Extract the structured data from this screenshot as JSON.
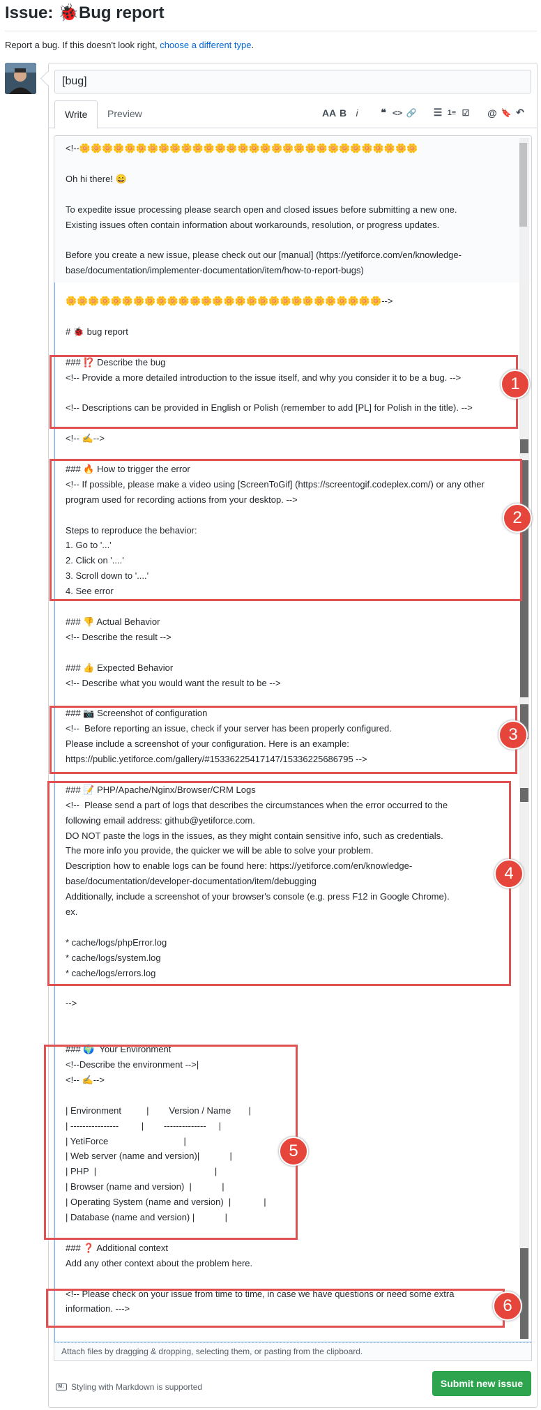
{
  "page": {
    "title_prefix": "Issue:",
    "title_emoji": "🐞",
    "title_text": "Bug report",
    "subtitle_text": "Report a bug. If this doesn't look right,",
    "subtitle_link": "choose a different type",
    "subtitle_end": "."
  },
  "form": {
    "title_value": "[bug]",
    "tabs": [
      "Write",
      "Preview"
    ],
    "toolbar": [
      "AA",
      "B",
      "i",
      "❝",
      "<>",
      "🔗",
      "☰",
      "1≡",
      "☑",
      "@",
      "🔖",
      "↶"
    ],
    "attach_text": "Attach files by dragging & dropping, selecting them, or pasting from the clipboard.",
    "markdown_note": "Styling with Markdown is supported",
    "submit_label": "Submit new issue"
  },
  "editor": {
    "lines": [
      "<!--🌼🌼🌼🌼🌼🌼🌼🌼🌼🌼🌼🌼🌼🌼🌼🌼🌼🌼🌼🌼🌼🌼🌼🌼🌼🌼🌼🌼🌼🌼",
      "",
      "Oh hi there! 😄",
      "",
      "To expedite issue processing please search open and closed issues before submitting a new one.",
      "Existing issues often contain information about workarounds, resolution, or progress updates.",
      "",
      "Before you create a new issue, please check out our [manual] (https://yetiforce.com/en/knowledge-",
      "base/documentation/implementer-documentation/item/how-to-report-bugs)",
      "",
      "🌼🌼🌼🌼🌼🌼🌼🌼🌼🌼🌼🌼🌼🌼🌼🌼🌼🌼🌼🌼🌼🌼🌼🌼🌼🌼🌼🌼-->",
      "",
      "# 🐞 bug report",
      "",
      "### ⁉️ Describe the bug",
      "<!-- Provide a more detailed introduction to the issue itself, and why you consider it to be a bug. -->",
      "",
      "<!-- Descriptions can be provided in English or Polish (remember to add [PL] for Polish in the title). -->",
      "",
      "<!-- ✍️-->",
      "",
      "### 🔥 How to trigger the error",
      "<!-- If possible, please make a video using [ScreenToGif] (https://screentogif.codeplex.com/) or any other",
      "program used for recording actions from your desktop. -->",
      "",
      "Steps to reproduce the behavior:",
      "1. Go to '...'",
      "2. Click on '....'",
      "3. Scroll down to '....'",
      "4. See error",
      "",
      "### 👎 Actual Behavior",
      "<!-- Describe the result -->",
      "",
      "### 👍 Expected Behavior",
      "<!-- Describe what you would want the result to be -->",
      "",
      "### 📷 Screenshot of configuration",
      "<!--  Before reporting an issue, check if your server has been properly configured.",
      "Please include a screenshot of your configuration. Here is an example:",
      "https://public.yetiforce.com/gallery/#15336225417147/15336225686795 -->",
      "",
      "### 📝 PHP/Apache/Nginx/Browser/CRM Logs",
      "<!--  Please send a part of logs that describes the circumstances when the error occurred to the",
      "following email address: github@yetiforce.com.",
      "DO NOT paste the logs in the issues, as they might contain sensitive info, such as credentials.",
      "The more info you provide, the quicker we will be able to solve your problem.",
      "Description how to enable logs can be found here: https://yetiforce.com/en/knowledge-",
      "base/documentation/developer-documentation/item/debugging",
      "Additionally, include a screenshot of your browser's console (e.g. press F12 in Google Chrome).",
      "ex.",
      "",
      "* cache/logs/phpError.log",
      "* cache/logs/system.log",
      "* cache/logs/errors.log",
      "",
      "-->",
      "",
      "",
      "### 🌍  Your Environment",
      "<!--Describe the environment -->|",
      "<!-- ✍️-->",
      "",
      "| Environment          |        Version / Name       |",
      "| ----------------         |        --------------     |",
      "| YetiForce                              |",
      "| Web server (name and version)|            |",
      "| PHP  |                                               |",
      "| Browser (name and version)  |            |",
      "| Operating System (name and version)  |             |",
      "| Database (name and version) |            |",
      "",
      "### ❓ Additional context",
      "Add any other context about the problem here.",
      "",
      "<!-- Please check on your issue from time to time, in case we have questions or need some extra",
      "information. --->"
    ]
  },
  "callouts": [
    "1",
    "2",
    "3",
    "4",
    "5",
    "6"
  ],
  "colors": {
    "submit_green": "#2ea44f",
    "callout_red": "#e05252",
    "badge_red": "#e5453b",
    "link_blue": "#0366d6"
  }
}
